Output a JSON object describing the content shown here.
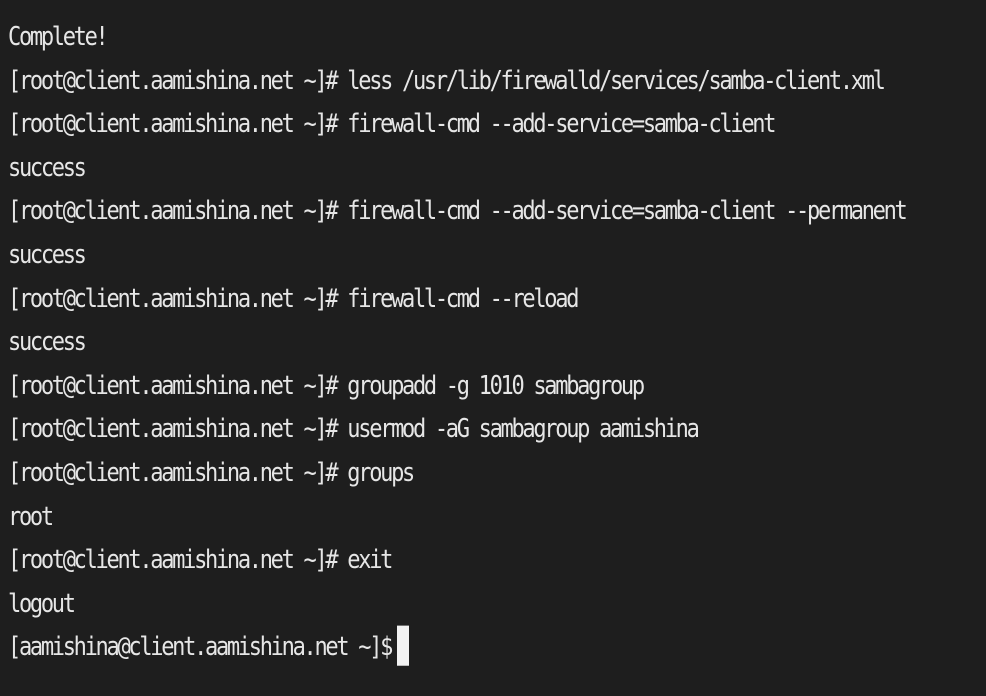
{
  "terminal": {
    "lines": [
      "Complete!",
      "[root@client.aamishina.net ~]# less /usr/lib/firewalld/services/samba-client.xml",
      "[root@client.aamishina.net ~]# firewall-cmd --add-service=samba-client",
      "success",
      "[root@client.aamishina.net ~]# firewall-cmd --add-service=samba-client --permanent",
      "success",
      "[root@client.aamishina.net ~]# firewall-cmd --reload",
      "success",
      "[root@client.aamishina.net ~]# groupadd -g 1010 sambagroup",
      "[root@client.aamishina.net ~]# usermod -aG sambagroup aamishina",
      "[root@client.aamishina.net ~]# groups",
      "root",
      "[root@client.aamishina.net ~]# exit",
      "logout"
    ],
    "prompt": "[aamishina@client.aamishina.net ~]$",
    "input_value": ""
  }
}
